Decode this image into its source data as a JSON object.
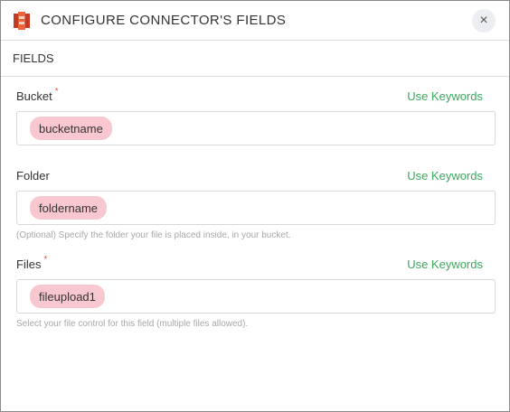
{
  "header": {
    "title": "CONFIGURE CONNECTOR'S FIELDS",
    "logo_icon": "connector-logo-icon",
    "close_icon": "close-icon",
    "close_symbol": "×"
  },
  "section": {
    "label": "FIELDS"
  },
  "fields": [
    {
      "label": "Bucket",
      "required": true,
      "required_mark": "*",
      "keywords_link": "Use Keywords",
      "value": "bucketname",
      "hint": ""
    },
    {
      "label": "Folder",
      "required": false,
      "required_mark": "",
      "keywords_link": "Use Keywords",
      "value": "foldername",
      "hint": "(Optional) Specify the folder your file is placed inside, in your bucket."
    },
    {
      "label": "Files",
      "required": true,
      "required_mark": "*",
      "keywords_link": "Use Keywords",
      "value": "fileupload1",
      "hint": "Select your file control for this field (multiple files allowed)."
    }
  ],
  "colors": {
    "accent_green": "#3aaa5c",
    "chip_pink": "#f8c7cf",
    "required_red": "#e55353",
    "logo_red": "#d9482b"
  }
}
